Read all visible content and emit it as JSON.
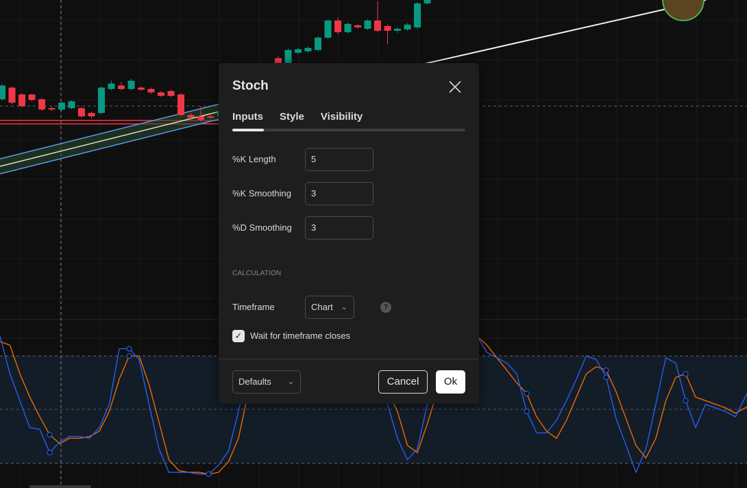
{
  "dialog": {
    "title": "Stoch",
    "tabs": [
      "Inputs",
      "Style",
      "Visibility"
    ],
    "active_tab": "Inputs",
    "inputs": [
      {
        "label": "%K Length",
        "value": "5"
      },
      {
        "label": "%K Smoothing",
        "value": "3"
      },
      {
        "label": "%D Smoothing",
        "value": "3"
      }
    ],
    "section_calculation": "CALCULATION",
    "timeframe": {
      "label": "Timeframe",
      "value": "Chart",
      "help": "?"
    },
    "wait_checkbox": {
      "label": "Wait for timeframe closes",
      "checked": true
    },
    "defaults_label": "Defaults",
    "cancel_label": "Cancel",
    "ok_label": "Ok"
  },
  "colors": {
    "up": "#089981",
    "down": "#f23645",
    "k_line": "#2962ff",
    "d_line": "#ff6d00",
    "channel": "#5b9cf6",
    "band": "#131d27"
  },
  "chart_background": {
    "candles_price_units": [
      [
        55,
        75,
        77,
        53
      ],
      [
        72,
        50,
        74,
        48
      ],
      [
        62,
        45,
        64,
        43
      ],
      [
        62,
        54,
        63,
        52
      ],
      [
        55,
        40,
        57,
        38
      ],
      [
        42,
        40,
        44,
        38
      ],
      [
        40,
        50,
        52,
        38
      ],
      [
        42,
        52,
        54,
        40
      ],
      [
        42,
        30,
        44,
        28
      ],
      [
        35,
        30,
        37,
        27
      ],
      [
        35,
        72,
        74,
        33
      ],
      [
        70,
        78,
        82,
        68
      ],
      [
        75,
        70,
        80,
        68
      ],
      [
        70,
        82,
        85,
        68
      ],
      [
        72,
        69,
        74,
        67
      ],
      [
        70,
        65,
        72,
        63
      ],
      [
        65,
        60,
        67,
        58
      ],
      [
        67,
        60,
        69,
        58
      ],
      [
        62,
        32,
        64,
        30
      ],
      [
        32,
        28,
        35,
        25
      ],
      [
        30,
        25,
        45,
        22
      ],
      [
        30,
        28,
        35,
        26
      ],
      [
        30,
        37,
        38,
        29
      ],
      [
        115,
        108,
        118,
        105
      ],
      [
        108,
        127,
        129,
        106
      ],
      [
        123,
        128,
        130,
        121
      ],
      [
        125,
        130,
        132,
        123
      ],
      [
        127,
        145,
        147,
        125
      ],
      [
        145,
        170,
        172,
        143
      ],
      [
        170,
        153,
        174,
        150
      ],
      [
        153,
        165,
        167,
        151
      ],
      [
        163,
        160,
        165,
        158
      ],
      [
        158,
        170,
        172,
        156
      ],
      [
        170,
        155,
        198,
        153
      ],
      [
        162,
        155,
        164,
        135
      ],
      [
        155,
        158,
        160,
        152
      ],
      [
        157,
        164,
        166,
        155
      ],
      [
        160,
        195,
        197,
        158
      ],
      [
        195,
        200,
        202,
        193
      ]
    ],
    "stoch_k": [
      91,
      70,
      55,
      40,
      39,
      26,
      32,
      35,
      35,
      34,
      40,
      53,
      84,
      84,
      78,
      53,
      28,
      15,
      15,
      15,
      14,
      14,
      19,
      27,
      49,
      75,
      90,
      95,
      95,
      92,
      95,
      95,
      90,
      92,
      95,
      95,
      90,
      85,
      70,
      53,
      34,
      22,
      28,
      53,
      76,
      90,
      95,
      95,
      91,
      82,
      79,
      76,
      70,
      49,
      37,
      37,
      44,
      55,
      67,
      80,
      78,
      68,
      45,
      30,
      15,
      28,
      53,
      79,
      76,
      55,
      40,
      53,
      51,
      49,
      46,
      57,
      68
    ],
    "stoch_d": [
      88,
      86,
      70,
      57,
      46,
      36,
      31,
      34,
      34,
      35,
      38,
      49,
      67,
      80,
      80,
      64,
      43,
      22,
      16,
      15,
      15,
      14,
      15,
      21,
      34,
      60,
      80,
      90,
      92,
      92,
      93,
      94,
      93,
      92,
      93,
      94,
      93,
      90,
      75,
      60,
      49,
      30,
      26,
      42,
      60,
      80,
      90,
      93,
      91,
      86,
      79,
      72,
      65,
      59,
      46,
      38,
      34,
      44,
      57,
      70,
      74,
      72,
      60,
      45,
      30,
      23,
      34,
      55,
      68,
      70,
      57,
      55,
      53,
      51,
      48,
      51,
      54
    ],
    "cross_indices": [
      5,
      13,
      21,
      53,
      61,
      69
    ]
  }
}
